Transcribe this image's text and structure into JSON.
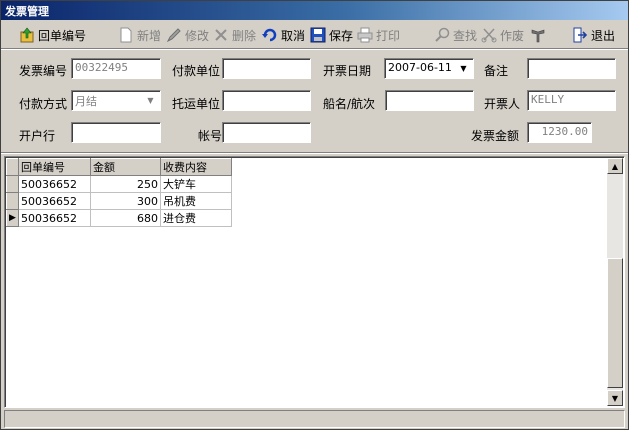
{
  "window": {
    "title": "发票管理"
  },
  "toolbar": {
    "receipt_no": "回单编号",
    "new": "新增",
    "edit": "修改",
    "delete": "删除",
    "cancel": "取消",
    "save": "保存",
    "print": "打印",
    "find": "查找",
    "void": "作废",
    "exit": "退出"
  },
  "form": {
    "invoice_no_label": "发票编号",
    "invoice_no_value": "00322495",
    "payer_label": "付款单位",
    "payer_value": "",
    "issue_date_label": "开票日期",
    "issue_date_value": "2007-06-11",
    "remark_label": "备注",
    "remark_value": "",
    "pay_method_label": "付款方式",
    "pay_method_value": "月结",
    "consignor_label": "托运单位",
    "consignor_value": "",
    "vessel_label": "船名/航次",
    "vessel_value": "",
    "issuer_label": "开票人",
    "issuer_value": "KELLY",
    "bank_label": "开户行",
    "bank_value": "",
    "account_label": "帐号",
    "account_value": "",
    "amount_label": "发票金额",
    "amount_value": "1230.00"
  },
  "grid": {
    "columns": [
      "回单编号",
      "金额",
      "收费内容"
    ],
    "rows": [
      {
        "receipt": "50036652",
        "amount": "250",
        "item": "大铲车"
      },
      {
        "receipt": "50036652",
        "amount": "300",
        "item": "吊机费"
      },
      {
        "receipt": "50036652",
        "amount": "680",
        "item": "进仓费"
      }
    ],
    "current_row_marker": "▶"
  },
  "colors": {
    "titlebar": "#0a246a",
    "face": "#d4d0c8",
    "disabled": "#808080"
  },
  "icons": [
    "folder-up-icon",
    "new-doc-icon",
    "edit-icon",
    "delete-icon",
    "undo-icon",
    "save-icon",
    "print-icon",
    "find-icon",
    "void-icon",
    "tool-icon",
    "exit-icon"
  ]
}
